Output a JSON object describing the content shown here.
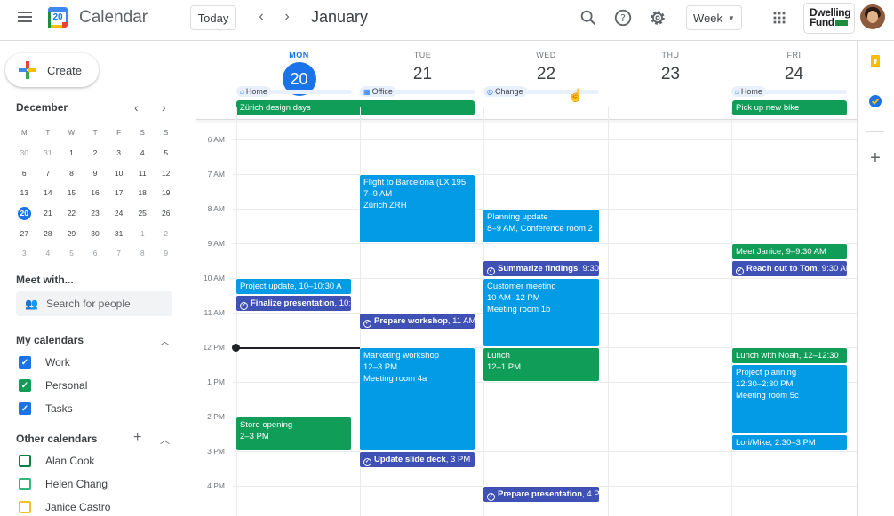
{
  "header": {
    "app_title": "Calendar",
    "logo_day": "20",
    "today_label": "Today",
    "month_title": "January",
    "view_label": "Week",
    "brand_line1": "Dwelling",
    "brand_line2": "Fund"
  },
  "sidebar": {
    "create_label": "Create",
    "mini_month": "December",
    "mini_weekdays": [
      "M",
      "T",
      "W",
      "T",
      "F",
      "S",
      "S"
    ],
    "mini_weeks": [
      [
        "30",
        "31",
        "1",
        "2",
        "3",
        "4",
        "5"
      ],
      [
        "6",
        "7",
        "8",
        "9",
        "10",
        "11",
        "12"
      ],
      [
        "13",
        "14",
        "15",
        "16",
        "17",
        "18",
        "19"
      ],
      [
        "20",
        "21",
        "22",
        "23",
        "24",
        "25",
        "26"
      ],
      [
        "27",
        "28",
        "29",
        "30",
        "31",
        "1",
        "2"
      ],
      [
        "3",
        "4",
        "5",
        "6",
        "7",
        "8",
        "9"
      ]
    ],
    "meet_title": "Meet with...",
    "search_placeholder": "Search for people",
    "my_calendars_title": "My calendars",
    "my_calendars": [
      {
        "name": "Work",
        "color": "#1a73e8",
        "checked": true
      },
      {
        "name": "Personal",
        "color": "#0f9d58",
        "checked": true
      },
      {
        "name": "Tasks",
        "color": "#1a73e8",
        "checked": true
      }
    ],
    "other_calendars_title": "Other calendars",
    "other_calendars": [
      {
        "name": "Alan Cook",
        "color": "#0b8043",
        "checked": false
      },
      {
        "name": "Helen Chang",
        "color": "#33b679",
        "checked": false
      },
      {
        "name": "Janice Castro",
        "color": "#f6bf26",
        "checked": false
      }
    ]
  },
  "days": [
    {
      "name": "MON",
      "num": "20",
      "today": true
    },
    {
      "name": "TUE",
      "num": "21",
      "today": false
    },
    {
      "name": "WED",
      "num": "22",
      "today": false
    },
    {
      "name": "THU",
      "num": "23",
      "today": false
    },
    {
      "name": "FRI",
      "num": "24",
      "today": false
    }
  ],
  "working_locations": [
    {
      "day": 0,
      "label": "Home",
      "icon": "home-icon"
    },
    {
      "day": 1,
      "label": "Office",
      "icon": "building-icon"
    },
    {
      "day": 2,
      "label": "Change",
      "icon": "location-icon"
    },
    {
      "day": 4,
      "label": "Home",
      "icon": "home-icon"
    }
  ],
  "all_day": [
    {
      "title": "Zürich design days"
    },
    {
      "title": "Pick up new bike"
    }
  ],
  "time_labels": [
    "6 AM",
    "7 AM",
    "8 AM",
    "9 AM",
    "10 AM",
    "11 AM",
    "12 PM",
    "1 PM",
    "2 PM",
    "3 PM",
    "4 PM"
  ],
  "events": {
    "flight": {
      "title": "Flight to Barcelona (LX 195",
      "time": "7–9 AM",
      "place": "Zürich ZRH"
    },
    "planning": {
      "title": "Planning update",
      "time": "8–9 AM, Conference room 2"
    },
    "meet_janice": {
      "title": "Meet Janice",
      "time": ", 9–9:30 AM"
    },
    "summarize": {
      "title": "Summarize findings",
      "time": ", 9:30"
    },
    "reach_tom": {
      "title": "Reach out to Tom",
      "time": ", 9:30 AM"
    },
    "project_update": {
      "title": "Project update",
      "time": ", 10–10:30 A"
    },
    "customer": {
      "title": "Customer meeting",
      "time": "10 AM–12 PM",
      "place": "Meeting room 1b"
    },
    "finalize": {
      "title": "Finalize presentation",
      "time": ", 10:"
    },
    "prep_workshop": {
      "title": "Prepare workshop",
      "time": ", 11 AM"
    },
    "marketing": {
      "title": "Marketing workshop",
      "time": "12–3 PM",
      "place": "Meeting room 4a"
    },
    "lunch": {
      "title": "Lunch",
      "time": "12–1 PM"
    },
    "lunch_noah": {
      "title": "Lunch with Noah",
      "time": ", 12–12:30"
    },
    "project_planning": {
      "title": "Project planning",
      "time": "12:30–2:30 PM",
      "place": "Meeting room 5c"
    },
    "store_opening": {
      "title": "Store opening",
      "time": "2–3 PM"
    },
    "lori_mike": {
      "title": "Lori/Mike",
      "time": ", 2:30–3 PM"
    },
    "update_slides": {
      "title": "Update slide deck",
      "time": ", 3 PM"
    },
    "prep_presentation": {
      "title": "Prepare presentation",
      "time": ", 4 P"
    }
  },
  "colors": {
    "accent": "#1a73e8",
    "event_blue": "#039be5",
    "event_green": "#0f9d58",
    "task_indigo": "#3f51b5"
  }
}
